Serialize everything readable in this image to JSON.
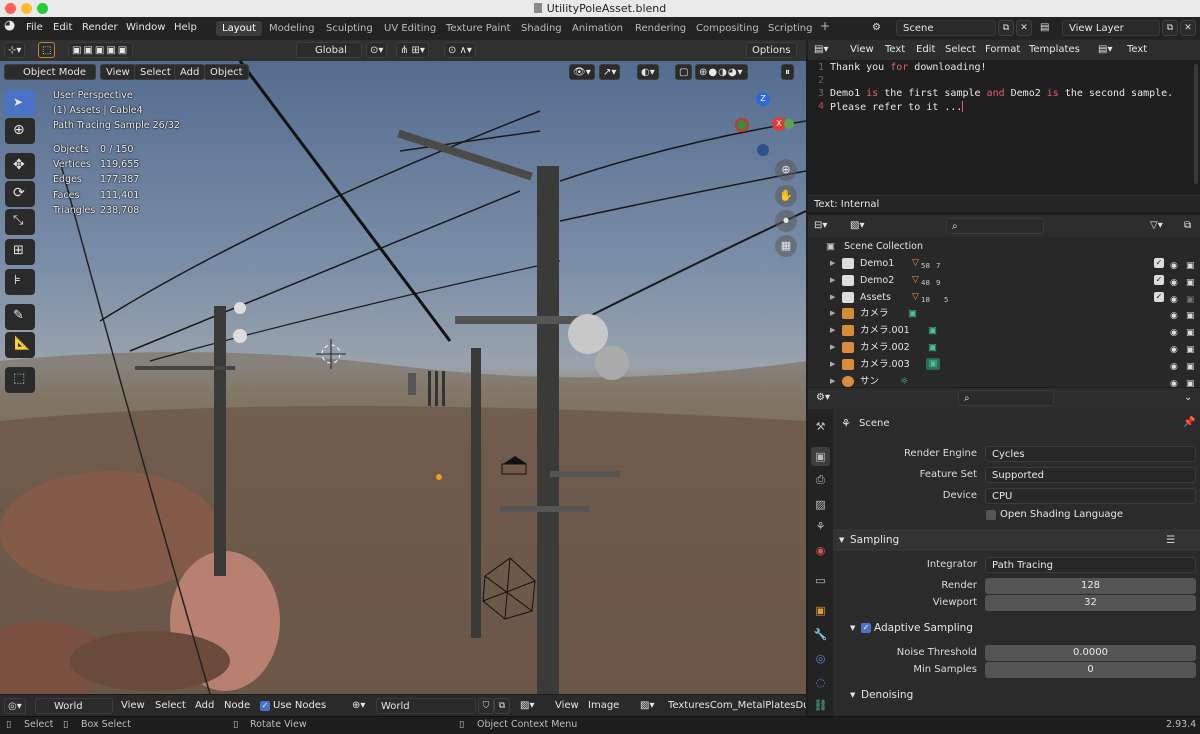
{
  "window": {
    "title": "UtilityPoleAsset.blend",
    "version": "2.93.4"
  },
  "menu": [
    "File",
    "Edit",
    "Render",
    "Window",
    "Help"
  ],
  "workspaces": [
    "Layout",
    "Modeling",
    "Sculpting",
    "UV Editing",
    "Texture Paint",
    "Shading",
    "Animation",
    "Rendering",
    "Compositing",
    "Scripting"
  ],
  "active_workspace": "Layout",
  "scene_field": "Scene",
  "view_layer_field": "View Layer",
  "toolbar": {
    "orientation": "Global",
    "options": "Options"
  },
  "viewport_header": {
    "mode": "Object Mode",
    "menus": [
      "View",
      "Select",
      "Add",
      "Object"
    ]
  },
  "viewport_overlay": {
    "line1": "User Perspective",
    "line2": "(1) Assets | Cable4",
    "line3": "Path Tracing Sample 26/32",
    "stats": [
      {
        "label": "Objects",
        "value": "0 / 150"
      },
      {
        "label": "Vertices",
        "value": "119,655"
      },
      {
        "label": "Edges",
        "value": "177,387"
      },
      {
        "label": "Faces",
        "value": "111,401"
      },
      {
        "label": "Triangles",
        "value": "238,708"
      }
    ]
  },
  "gizmo": {
    "z": "Z",
    "x": "X"
  },
  "text_editor": {
    "menus": [
      "View",
      "Text",
      "Edit",
      "Select",
      "Format",
      "Templates"
    ],
    "datablock": "Text",
    "line_numbers": [
      "1",
      "2",
      "3",
      "4"
    ],
    "lines": {
      "l1a": "Thank you ",
      "l1b": "for",
      "l1c": " downloading!",
      "l3a": "Demo1 ",
      "l3b": "is",
      "l3c": " the first sample ",
      "l3d": "and",
      "l3e": " Demo2 ",
      "l3f": "is",
      "l3g": " the second sample.",
      "l4": "Please refer to it ..."
    },
    "footer": "Text: Internal"
  },
  "outliner": {
    "root": "Scene Collection",
    "items": [
      {
        "label": "Demo1",
        "badge": "7",
        "sub": "58"
      },
      {
        "label": "Demo2",
        "badge": "9",
        "sub": "48"
      },
      {
        "label": "Assets",
        "badge": "5",
        "sub": "18"
      },
      {
        "label": "カメラ"
      },
      {
        "label": "カメラ.001"
      },
      {
        "label": "カメラ.002"
      },
      {
        "label": "カメラ.003"
      },
      {
        "label": "サン"
      }
    ]
  },
  "properties": {
    "context": "Scene",
    "render_engine_label": "Render Engine",
    "render_engine": "Cycles",
    "feature_set_label": "Feature Set",
    "feature_set": "Supported",
    "device_label": "Device",
    "device": "CPU",
    "osl_label": "Open Shading Language",
    "sampling_label": "Sampling",
    "integrator_label": "Integrator",
    "integrator": "Path Tracing",
    "render_label": "Render",
    "render_value": "128",
    "viewport_label": "Viewport",
    "viewport_value": "32",
    "adaptive_label": "Adaptive Sampling",
    "noise_label": "Noise Threshold",
    "noise_value": "0.0000",
    "min_samples_label": "Min Samples",
    "min_samples_value": "0",
    "denoising_label": "Denoising"
  },
  "bottom_editor": {
    "world_dd": "World",
    "menus": [
      "View",
      "Select",
      "Add",
      "Node"
    ],
    "use_nodes": "Use Nodes",
    "world_field": "World",
    "image_menus": [
      "View",
      "Image"
    ],
    "image_name": "TexturesCom_MetalPlatesDucts"
  },
  "status": {
    "select": "Select",
    "box_select": "Box Select",
    "rotate": "Rotate View",
    "context_menu": "Object Context Menu"
  },
  "colors": {
    "accent": "#4a72c6",
    "header": "#303030",
    "panel": "#2b2b2b",
    "field": "#545454",
    "highlight_red": "#e85c6f"
  }
}
